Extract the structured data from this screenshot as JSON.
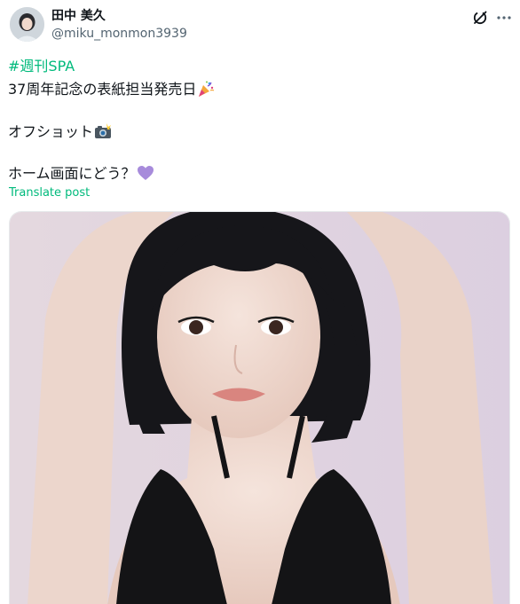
{
  "author": {
    "display_name": "田中 美久",
    "handle": "@miku_monmon3939"
  },
  "post": {
    "hashtag": "#週刊SPA",
    "line1": "37周年記念の表紙担当発売日",
    "line2": "オフショット",
    "line3": "ホーム画面にどう？",
    "translate_label": "Translate post"
  },
  "icons": {
    "party": "party-popper-icon",
    "camera": "camera-flash-icon",
    "heart": "purple-heart-icon",
    "grok": "grok-icon",
    "more": "more-icon"
  },
  "colors": {
    "accent": "#00ba7c",
    "text": "#0f1419",
    "secondary": "#536471",
    "heart": "#a78bdb"
  }
}
